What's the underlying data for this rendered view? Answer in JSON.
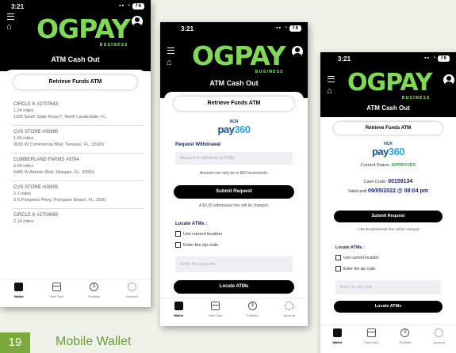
{
  "colors": {
    "accent": "#7ed957",
    "brand_dark": "#000000",
    "footer_green": "#7aaa3a",
    "status_approved": "#2e9e44",
    "ncr_blue": "#1a4d8f"
  },
  "logo": {
    "text": "OGPAY",
    "sub": "BUSINESS"
  },
  "status_bar": {
    "time": "3:21",
    "battery": "76"
  },
  "screen1": {
    "title": "ATM Cash Out",
    "retrieve_label": "Retrieve Funds ATM",
    "atms": [
      {
        "name": "CIRCLE K #2707643",
        "distance": "1.24 miles",
        "address": "1190 South State Road 7, North Lauderdale, FL,"
      },
      {
        "name": "CVS STORE #00990",
        "distance": "1.99 miles",
        "address": "3915 W Commercial Blvd, Tamarac, FL, 33309"
      },
      {
        "name": "CUMBERLAND FARMS #9784",
        "distance": "2.09 miles",
        "address": "5485 W Atlantic Blvd, Margate, FL, 33063"
      },
      {
        "name": "CVS STORE #03905",
        "distance": "2.1 miles",
        "address": "3 S Pompano Pkwy, Pompano Beach, FL, 3306"
      },
      {
        "name": "CIRCLE K #2704865",
        "distance": "2.14 miles",
        "address": ""
      }
    ]
  },
  "screen2": {
    "title": "ATM Cash Out",
    "retrieve_label": "Retrieve Funds ATM",
    "ncr_top": "NCR",
    "ncr_pay": "pay",
    "ncr_num": "360",
    "request_label": "Request Withdrawal",
    "amount_placeholder": "Amount to withdraw (USD$)",
    "increments_note": "Amount can only be in $20 increments.",
    "submit_label": "Submit Request",
    "fee_note": "A $3.00 withdrawal free will be charged.",
    "locate_label": "Locate ATMs :",
    "use_location": "Use current location",
    "enter_zip": "Enter the zip code",
    "zip_placeholder": "Enter the zip code",
    "locate_button": "Locate ATMs"
  },
  "screen3": {
    "title": "ATM Cash Out",
    "retrieve_label": "Retrieve Funds ATM",
    "ncr_top": "NCR",
    "ncr_pay": "pay",
    "ncr_num": "360",
    "status_prefix": "Current Status:",
    "status_value": "APPROVED",
    "cash_code_prefix": "Cash Code:",
    "cash_code": "00159134",
    "valid_prefix": "Valid until",
    "valid_until": "09/05/2022 @ 08:04 pm",
    "submit_label": "Submit Request",
    "fee_note": "A $3.00 withdrawal free will be charged",
    "locate_label": "Locate ATMs :",
    "use_location": "Use current location",
    "enter_zip": "Enter the zip code",
    "zip_placeholder": "Enter the zip code",
    "locate_button": "Locate ATMs"
  },
  "tabs": [
    {
      "label": "Wallet",
      "icon": "wallet-icon"
    },
    {
      "label": "Visa Card",
      "icon": "card-icon"
    },
    {
      "label": "Portfolio",
      "icon": "portfolio-icon"
    },
    {
      "label": "Account",
      "icon": "gear-icon"
    }
  ],
  "footer": {
    "page_number": "19",
    "title": "Mobile Wallet"
  }
}
